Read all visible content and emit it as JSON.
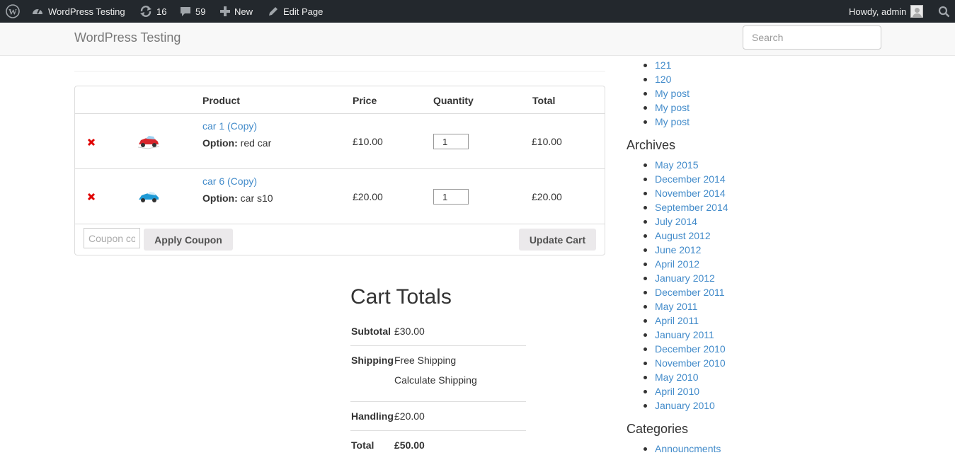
{
  "admin_bar": {
    "site_name": "WordPress Testing",
    "updates_count": "16",
    "comments_count": "59",
    "new_label": "New",
    "edit_label": "Edit Page",
    "greeting": "Howdy, admin"
  },
  "navbar": {
    "brand": "WordPress Testing",
    "search_placeholder": "Search"
  },
  "cart": {
    "headers": {
      "product": "Product",
      "price": "Price",
      "quantity": "Quantity",
      "total": "Total"
    },
    "items": [
      {
        "name": "car 1 (Copy)",
        "option_label": "Option:",
        "option_value": "red car",
        "price": "£10.00",
        "qty": "1",
        "total": "£10.00",
        "thumb_color": "#d8262c"
      },
      {
        "name": "car 6 (Copy)",
        "option_label": "Option:",
        "option_value": "car s10",
        "price": "£20.00",
        "qty": "1",
        "total": "£20.00",
        "thumb_color": "#1e9ad6"
      }
    ],
    "coupon_placeholder": "Coupon code",
    "apply_coupon": "Apply Coupon",
    "update_cart": "Update Cart",
    "remove_color": "#e00000"
  },
  "totals": {
    "title": "Cart Totals",
    "subtotal_label": "Subtotal",
    "subtotal_value": "£30.00",
    "shipping_label": "Shipping",
    "shipping_value": "Free Shipping",
    "calc_shipping": "Calculate Shipping",
    "handling_label": "Handling",
    "handling_value": "£20.00",
    "total_label": "Total",
    "total_value": "£50.00"
  },
  "sidebar": {
    "recent_posts": [
      "121",
      "120",
      "My post",
      "My post",
      "My post"
    ],
    "archives_title": "Archives",
    "archives": [
      "May 2015",
      "December 2014",
      "November 2014",
      "September 2014",
      "July 2014",
      "August 2012",
      "June 2012",
      "April 2012",
      "January 2012",
      "December 2011",
      "May 2011",
      "April 2011",
      "January 2011",
      "December 2010",
      "November 2010",
      "May 2010",
      "April 2010",
      "January 2010"
    ],
    "categories_title": "Categories",
    "categories": [
      "Announcments"
    ]
  },
  "colors": {
    "link": "#428bca",
    "admin_bar_bg": "#23282d"
  }
}
